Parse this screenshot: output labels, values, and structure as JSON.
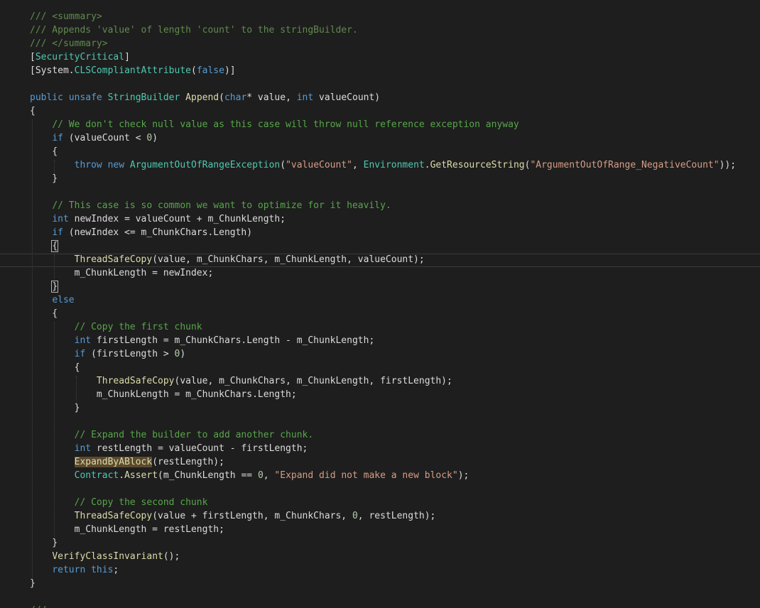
{
  "editor": {
    "colors": {
      "background": "#1e1e1e",
      "comment": "#57a64a",
      "keyword": "#569cd6",
      "type": "#4ec9b0",
      "string": "#d69d85",
      "number": "#b5cea8",
      "identifier": "#dcdcdc",
      "method": "#dcdcaa",
      "highlight": "#5c4a2e"
    },
    "lines": [
      [
        {
          "t": "/// <summary>",
          "c": "doc"
        }
      ],
      [
        {
          "t": "/// Appends 'value' of length 'count' to the stringBuilder.",
          "c": "doc"
        }
      ],
      [
        {
          "t": "/// </summary>",
          "c": "doc"
        }
      ],
      [
        {
          "t": "[",
          "c": "id"
        },
        {
          "t": "SecurityCritical",
          "c": "attr"
        },
        {
          "t": "]",
          "c": "id"
        }
      ],
      [
        {
          "t": "[",
          "c": "id"
        },
        {
          "t": "System",
          "c": "id"
        },
        {
          "t": ".",
          "c": "id"
        },
        {
          "t": "CLSCompliantAttribute",
          "c": "attr"
        },
        {
          "t": "(",
          "c": "id"
        },
        {
          "t": "false",
          "c": "kw"
        },
        {
          "t": ")]",
          "c": "id"
        }
      ],
      [],
      [
        {
          "t": "public",
          "c": "kw"
        },
        {
          "t": " ",
          "c": "id"
        },
        {
          "t": "unsafe",
          "c": "kw"
        },
        {
          "t": " ",
          "c": "id"
        },
        {
          "t": "StringBuilder",
          "c": "type"
        },
        {
          "t": " ",
          "c": "id"
        },
        {
          "t": "Append",
          "c": "fn"
        },
        {
          "t": "(",
          "c": "id"
        },
        {
          "t": "char",
          "c": "kw"
        },
        {
          "t": "* value, ",
          "c": "id"
        },
        {
          "t": "int",
          "c": "kw"
        },
        {
          "t": " valueCount)",
          "c": "id"
        }
      ],
      [
        {
          "t": "{",
          "c": "id"
        }
      ],
      [
        {
          "t": "    ",
          "c": "id"
        },
        {
          "t": "// We don't check null value as this case will throw null reference exception anyway",
          "c": "com"
        }
      ],
      [
        {
          "t": "    ",
          "c": "id"
        },
        {
          "t": "if",
          "c": "kw"
        },
        {
          "t": " (valueCount < ",
          "c": "id"
        },
        {
          "t": "0",
          "c": "num"
        },
        {
          "t": ")",
          "c": "id"
        }
      ],
      [
        {
          "t": "    {",
          "c": "id"
        }
      ],
      [
        {
          "t": "        ",
          "c": "id"
        },
        {
          "t": "throw",
          "c": "kw"
        },
        {
          "t": " ",
          "c": "id"
        },
        {
          "t": "new",
          "c": "kw"
        },
        {
          "t": " ",
          "c": "id"
        },
        {
          "t": "ArgumentOutOfRangeException",
          "c": "type"
        },
        {
          "t": "(",
          "c": "id"
        },
        {
          "t": "\"valueCount\"",
          "c": "str"
        },
        {
          "t": ", ",
          "c": "id"
        },
        {
          "t": "Environment",
          "c": "type"
        },
        {
          "t": ".",
          "c": "id"
        },
        {
          "t": "GetResourceString",
          "c": "fn"
        },
        {
          "t": "(",
          "c": "id"
        },
        {
          "t": "\"ArgumentOutOfRange_NegativeCount\"",
          "c": "str"
        },
        {
          "t": "));",
          "c": "id"
        }
      ],
      [
        {
          "t": "    }",
          "c": "id"
        }
      ],
      [],
      [
        {
          "t": "    ",
          "c": "id"
        },
        {
          "t": "// This case is so common we want to optimize for it heavily.",
          "c": "com"
        }
      ],
      [
        {
          "t": "    ",
          "c": "id"
        },
        {
          "t": "int",
          "c": "kw"
        },
        {
          "t": " newIndex = valueCount + m_ChunkLength;",
          "c": "id"
        }
      ],
      [
        {
          "t": "    ",
          "c": "id"
        },
        {
          "t": "if",
          "c": "kw"
        },
        {
          "t": " (newIndex <= m_ChunkChars.Length)",
          "c": "id"
        }
      ],
      [
        {
          "t": "    ",
          "c": "id"
        },
        {
          "t": "{",
          "c": "id",
          "m": "brace"
        }
      ],
      [
        {
          "t": "        ",
          "c": "id"
        },
        {
          "t": "ThreadSafeCopy",
          "c": "fn"
        },
        {
          "t": "(value, m_ChunkChars, m_ChunkLength, valueCount);",
          "c": "id"
        }
      ],
      [
        {
          "t": "        m_ChunkLength = newIndex;",
          "c": "id"
        }
      ],
      [
        {
          "t": "    ",
          "c": "id"
        },
        {
          "t": "}",
          "c": "id",
          "m": "brace"
        }
      ],
      [
        {
          "t": "    ",
          "c": "id"
        },
        {
          "t": "else",
          "c": "kw"
        }
      ],
      [
        {
          "t": "    {",
          "c": "id"
        }
      ],
      [
        {
          "t": "        ",
          "c": "id"
        },
        {
          "t": "// Copy the first chunk",
          "c": "com"
        }
      ],
      [
        {
          "t": "        ",
          "c": "id"
        },
        {
          "t": "int",
          "c": "kw"
        },
        {
          "t": " firstLength = m_ChunkChars.Length - m_ChunkLength;",
          "c": "id"
        }
      ],
      [
        {
          "t": "        ",
          "c": "id"
        },
        {
          "t": "if",
          "c": "kw"
        },
        {
          "t": " (firstLength > ",
          "c": "id"
        },
        {
          "t": "0",
          "c": "num"
        },
        {
          "t": ")",
          "c": "id"
        }
      ],
      [
        {
          "t": "        {",
          "c": "id"
        }
      ],
      [
        {
          "t": "            ",
          "c": "id"
        },
        {
          "t": "ThreadSafeCopy",
          "c": "fn"
        },
        {
          "t": "(value, m_ChunkChars, m_ChunkLength, firstLength);",
          "c": "id"
        }
      ],
      [
        {
          "t": "            m_ChunkLength = m_ChunkChars.Length;",
          "c": "id"
        }
      ],
      [
        {
          "t": "        }",
          "c": "id"
        }
      ],
      [],
      [
        {
          "t": "        ",
          "c": "id"
        },
        {
          "t": "// Expand the builder to add another chunk.",
          "c": "com"
        }
      ],
      [
        {
          "t": "        ",
          "c": "id"
        },
        {
          "t": "int",
          "c": "kw"
        },
        {
          "t": " restLength = valueCount - firstLength;",
          "c": "id"
        }
      ],
      [
        {
          "t": "        ",
          "c": "id"
        },
        {
          "t": "ExpandByABlock",
          "c": "fn",
          "m": "hl"
        },
        {
          "t": "(restLength);",
          "c": "id"
        }
      ],
      [
        {
          "t": "        ",
          "c": "id"
        },
        {
          "t": "Contract",
          "c": "type"
        },
        {
          "t": ".",
          "c": "id"
        },
        {
          "t": "Assert",
          "c": "fn"
        },
        {
          "t": "(m_ChunkLength == ",
          "c": "id"
        },
        {
          "t": "0",
          "c": "num"
        },
        {
          "t": ", ",
          "c": "id"
        },
        {
          "t": "\"Expand did not make a new block\"",
          "c": "str"
        },
        {
          "t": ");",
          "c": "id"
        }
      ],
      [],
      [
        {
          "t": "        ",
          "c": "id"
        },
        {
          "t": "// Copy the second chunk",
          "c": "com"
        }
      ],
      [
        {
          "t": "        ",
          "c": "id"
        },
        {
          "t": "ThreadSafeCopy",
          "c": "fn"
        },
        {
          "t": "(value + firstLength, m_ChunkChars, ",
          "c": "id"
        },
        {
          "t": "0",
          "c": "num"
        },
        {
          "t": ", restLength);",
          "c": "id"
        }
      ],
      [
        {
          "t": "        m_ChunkLength = restLength;",
          "c": "id"
        }
      ],
      [
        {
          "t": "    }",
          "c": "id"
        }
      ],
      [
        {
          "t": "    ",
          "c": "id"
        },
        {
          "t": "VerifyClassInvariant",
          "c": "fn"
        },
        {
          "t": "();",
          "c": "id"
        }
      ],
      [
        {
          "t": "    ",
          "c": "id"
        },
        {
          "t": "return",
          "c": "kw"
        },
        {
          "t": " ",
          "c": "id"
        },
        {
          "t": "this",
          "c": "kw"
        },
        {
          "t": ";",
          "c": "id"
        }
      ],
      [
        {
          "t": "}",
          "c": "id"
        }
      ],
      [],
      [
        {
          "t": "///",
          "c": "doc"
        }
      ]
    ]
  }
}
